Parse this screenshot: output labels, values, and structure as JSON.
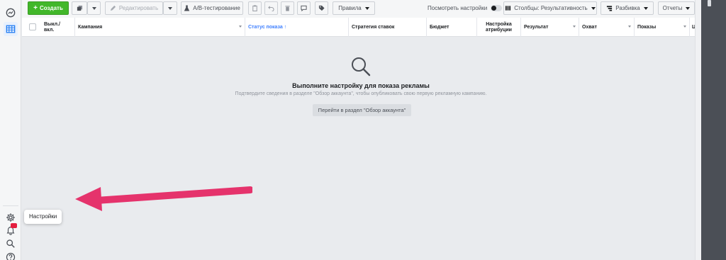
{
  "toolbar": {
    "create_label": "Создать",
    "edit_label": "Редактировать",
    "ab_test_label": "A/B-тестирование",
    "rules_label": "Правила",
    "view_settings_label": "Посмотреть настройки",
    "columns_label": "Столбцы: Результативность",
    "breakdown_label": "Разбивка",
    "reports_label": "Отчеты"
  },
  "table": {
    "columns": [
      {
        "label": "Выкл./ вкл."
      },
      {
        "label": "Кампания"
      },
      {
        "label": "Статус показа ↑"
      },
      {
        "label": "Стратегия ставок"
      },
      {
        "label": "Бюджет"
      },
      {
        "label": "Настройка атрибуции"
      },
      {
        "label": "Результат"
      },
      {
        "label": "Охват"
      },
      {
        "label": "Показы"
      },
      {
        "label": "Це"
      }
    ]
  },
  "empty_state": {
    "title": "Выполните настройку для показа рекламы",
    "subtitle": "Подтвердите сведения в разделе \"Обзор аккаунта\", чтобы опубликовать свою первую рекламную кампанию.",
    "button_label": "Перейти в раздел \"Обзор аккаунта\""
  },
  "sidebar": {
    "tooltip": "Настройки",
    "items": [
      {
        "icon": "dashboard-icon"
      },
      {
        "icon": "campaigns-table-icon",
        "active": true
      },
      {
        "icon": "gear-icon"
      },
      {
        "icon": "bell-icon",
        "badge": true
      },
      {
        "icon": "search-icon"
      },
      {
        "icon": "help-icon"
      }
    ]
  },
  "colors": {
    "accent": "#42b72a",
    "sort_blue": "#4080ff",
    "arrow": "#e5336c",
    "background": "#e9ebee"
  }
}
